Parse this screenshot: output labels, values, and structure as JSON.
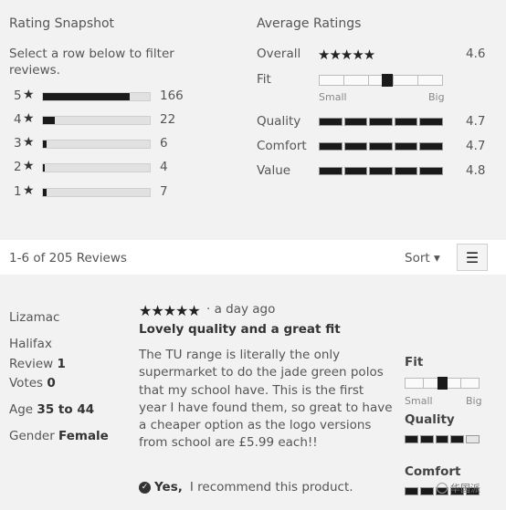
{
  "snapshot": {
    "title": "Rating Snapshot",
    "hint": "Select a row below to filter reviews.",
    "star_icon": "★",
    "rows": [
      {
        "stars": "5",
        "count": "166",
        "fraction": 0.81
      },
      {
        "stars": "4",
        "count": "22",
        "fraction": 0.11
      },
      {
        "stars": "3",
        "count": "6",
        "fraction": 0.03
      },
      {
        "stars": "2",
        "count": "4",
        "fraction": 0.02
      },
      {
        "stars": "1",
        "count": "7",
        "fraction": 0.03
      }
    ]
  },
  "average": {
    "title": "Average Ratings",
    "overall_label": "Overall",
    "overall_value": "4.6",
    "overall_stars_glyph": "★★★★★",
    "fit_label": "Fit",
    "fit_small": "Small",
    "fit_big": "Big",
    "fit_position": 0.55,
    "bars": [
      {
        "label": "Quality",
        "value": "4.7"
      },
      {
        "label": "Comfort",
        "value": "4.7"
      },
      {
        "label": "Value",
        "value": "4.8"
      }
    ]
  },
  "reviews_bar": {
    "count_text": "1-6 of 205 Reviews",
    "sort_label": "Sort ▾",
    "menu_icon": "☰"
  },
  "review": {
    "author": "Lizamac",
    "location": "Halifax",
    "review_label": "Review",
    "review_count": "1",
    "votes_label": "Votes",
    "votes_count": "0",
    "age_label": "Age",
    "age_value": "35 to 44",
    "gender_label": "Gender",
    "gender_value": "Female",
    "stars_glyph": "★★★★★",
    "date": "· a day ago",
    "title": "Lovely quality and a great fit",
    "body": "The TU range is literally the only supermarket to do the jade green polos that my school have. This is the first year I have found them, so great to have a cheaper option as the logo versions from school are £5.99 each!!",
    "recommend_yes": "Yes,",
    "recommend_text": "I recommend this product.",
    "fit_label": "Fit",
    "fit_small": "Small",
    "fit_big": "Big",
    "quality_label": "Quality",
    "quality_segments_filled": 4,
    "comfort_label": "Comfort"
  },
  "watermark": {
    "text": "华国派"
  }
}
